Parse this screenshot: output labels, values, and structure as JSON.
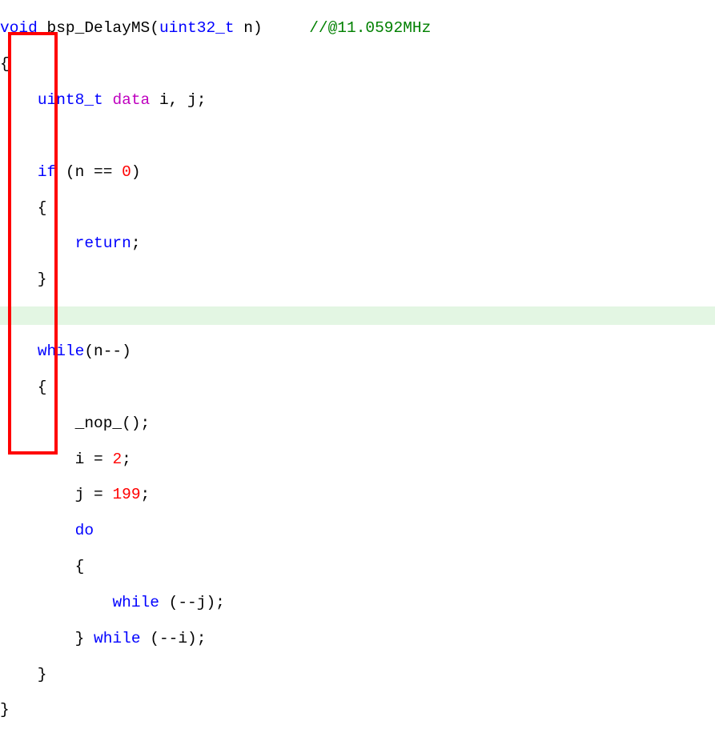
{
  "code": {
    "l1_void": "void",
    "l1_sig": " bsp_DelayMS(",
    "l1_type": "uint32_t",
    "l1_arg": " n)     ",
    "l1_comment": "//@11.0592MHz",
    "l2": "{",
    "l3_pre": "    ",
    "l3_type": "uint8_t",
    "l3_sp": " ",
    "l3_data": "data",
    "l3_vars": " i, j;",
    "l4": "",
    "l5_pre": "    ",
    "l5_if": "if",
    "l5_cond_open": " (n == ",
    "l5_zero": "0",
    "l5_cond_close": ")",
    "l6": "    {",
    "l7_pre": "        ",
    "l7_return": "return",
    "l7_semi": ";",
    "l8": "    }",
    "l9": "",
    "l10_pre": "    ",
    "l10_while": "while",
    "l10_cond": "(n--)",
    "l11": "    {",
    "l12": "        _nop_();",
    "l13_pre": "        i = ",
    "l13_num": "2",
    "l13_post": ";",
    "l14_pre": "        j = ",
    "l14_num": "199",
    "l14_post": ";",
    "l15_pre": "        ",
    "l15_do": "do",
    "l16": "        {",
    "l17_pre": "            ",
    "l17_while": "while",
    "l17_cond": " (--j);",
    "l18_pre": "        } ",
    "l18_while": "while",
    "l18_cond": " (--i);",
    "l19": "    }",
    "l20": "}"
  }
}
